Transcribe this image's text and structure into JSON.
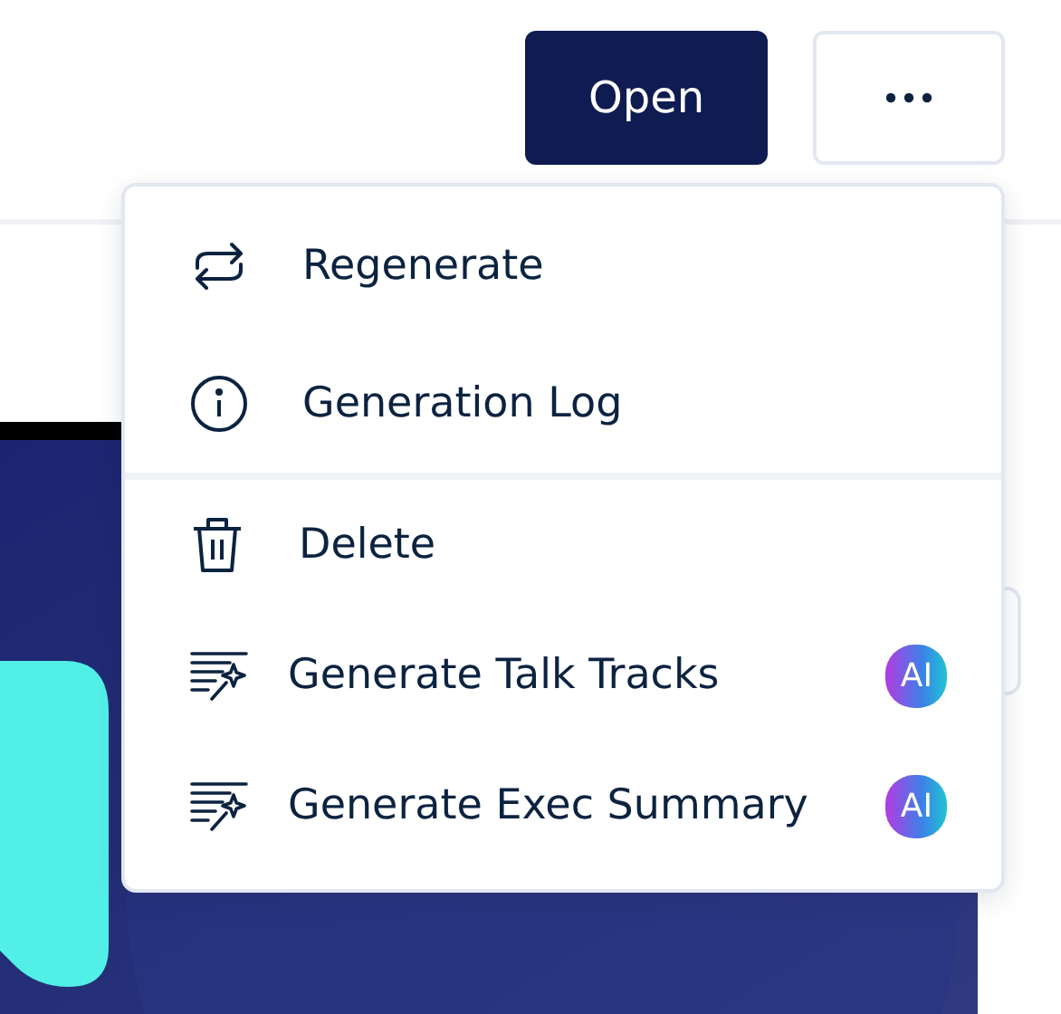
{
  "toolbar": {
    "open_button": "Open"
  },
  "menu": {
    "sections": [
      {
        "items": [
          {
            "kind": "regenerate",
            "label": "Regenerate"
          },
          {
            "kind": "info",
            "label": "Generation Log"
          }
        ]
      },
      {
        "items": [
          {
            "kind": "delete",
            "label": "Delete"
          },
          {
            "kind": "generate",
            "label": "Generate Talk Tracks",
            "badge": "AI"
          },
          {
            "kind": "generate",
            "label": "Generate Exec Summary",
            "badge": "AI"
          }
        ]
      }
    ]
  }
}
